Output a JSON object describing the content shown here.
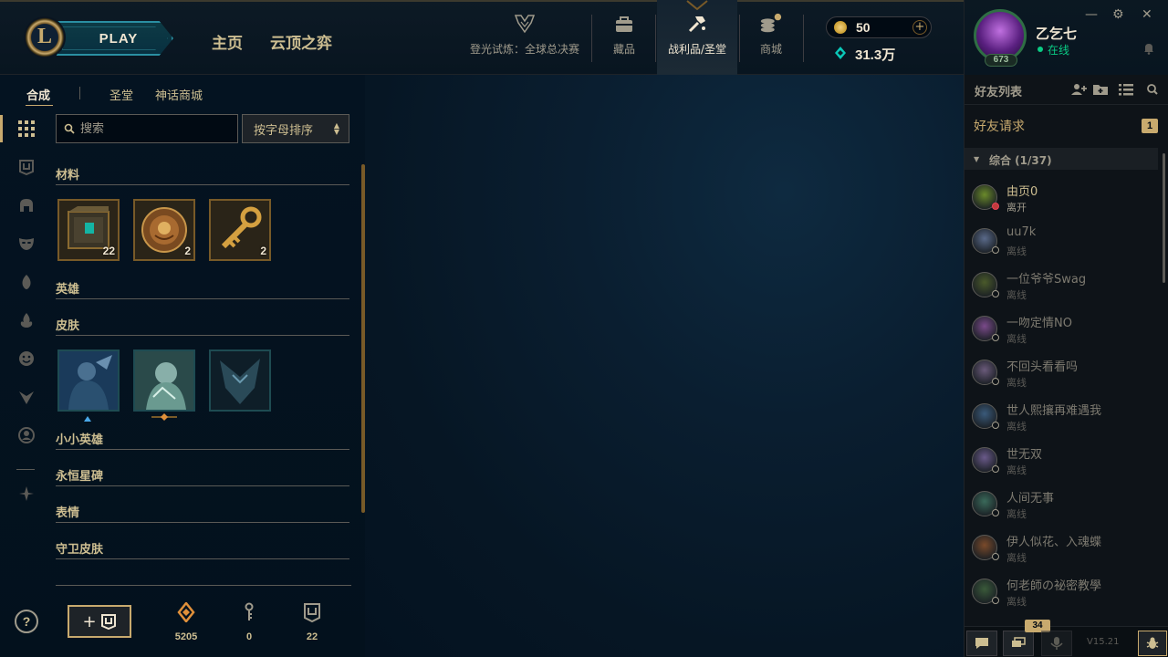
{
  "header": {
    "logo_letter": "L",
    "play_label": "PLAY",
    "nav_home": "主页",
    "nav_tft": "云顶之弈",
    "icons": [
      {
        "name": "worlds-trophy-icon",
        "label": "登光试炼：全球总决赛"
      },
      {
        "name": "collection-bag-icon",
        "label": "藏品"
      },
      {
        "name": "loot-hammer-icon",
        "label": "战利品/圣堂"
      },
      {
        "name": "store-coins-icon",
        "label": "商城"
      }
    ],
    "rp": "50",
    "rp_plus": "+",
    "be": "31.3万"
  },
  "profile": {
    "name": "乙乞七",
    "status": "在线",
    "level": "673"
  },
  "window": {
    "minimize": "✕",
    "settings": "⚙",
    "close": "✕"
  },
  "subnav": {
    "craft": "合成",
    "sanctum": "圣堂",
    "mythic": "神话商城"
  },
  "inventory": {
    "search_placeholder": "搜索",
    "sort_label": "按字母排序",
    "categories": {
      "materials": "材料",
      "champions": "英雄",
      "skins": "皮肤",
      "little_legends": "小小英雄",
      "eternals": "永恒星碑",
      "emotes": "表情",
      "ward_skins": "守卫皮肤"
    },
    "materials": [
      {
        "name": "hextech-chest",
        "count": "22"
      },
      {
        "name": "orb",
        "count": "2"
      },
      {
        "name": "key",
        "count": "2"
      }
    ]
  },
  "currencies": [
    {
      "name": "orange-essence",
      "value": "5205"
    },
    {
      "name": "key-fragment",
      "value": "0"
    },
    {
      "name": "chest",
      "value": "22"
    }
  ],
  "help_label": "?",
  "add_chest_label": "+",
  "friends": {
    "title": "好友列表",
    "requests_label": "好友请求",
    "requests_count": "1",
    "group_label": "综合 (1/37)",
    "list": [
      {
        "name": "由页0",
        "status": "离开",
        "state": "away",
        "color": "#6a8a2a"
      },
      {
        "name": "uu7k",
        "status": "离线",
        "state": "offline",
        "color": "#5a6a8a"
      },
      {
        "name": "一位爷爷Swag",
        "status": "离线",
        "state": "offline",
        "color": "#4a5a2a"
      },
      {
        "name": "一吻定情NO",
        "status": "离线",
        "state": "offline",
        "color": "#7a4a8a"
      },
      {
        "name": "不回头看看吗",
        "status": "离线",
        "state": "offline",
        "color": "#6a5a7a"
      },
      {
        "name": "世人熙攘再难遇我",
        "status": "离线",
        "state": "offline",
        "color": "#3a5a7a"
      },
      {
        "name": "世无双",
        "status": "离线",
        "state": "offline",
        "color": "#6a5a8a"
      },
      {
        "name": "人间无事",
        "status": "离线",
        "state": "offline",
        "color": "#3a6a5a"
      },
      {
        "name": "伊人似花、入魂蝶",
        "status": "离线",
        "state": "offline",
        "color": "#7a4a2a"
      },
      {
        "name": "何老師の祕密教學",
        "status": "离线",
        "state": "offline",
        "color": "#3a5a3a"
      }
    ],
    "chat_badge": "34",
    "version": "V15.21"
  }
}
